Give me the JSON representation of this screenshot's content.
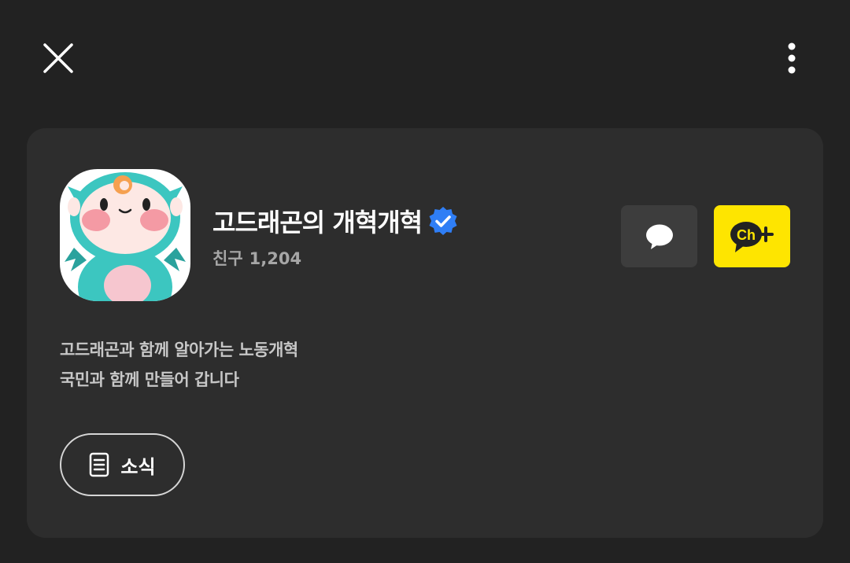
{
  "header": {
    "close_icon": "close-icon",
    "more_icon": "more-vertical-icon"
  },
  "profile": {
    "name": "고드래곤의 개혁개혁",
    "verified_icon": "verified-badge-icon",
    "friends_label": "친구",
    "friends_count": "1,204",
    "description_lines": [
      "고드래곤과 함께 알아가는 노동개혁",
      "국민과 함께 만들어 갑니다"
    ]
  },
  "actions": {
    "chat_icon": "chat-bubble-icon",
    "channel_add_icon": "channel-add-icon",
    "channel_add_text": "Ch"
  },
  "news_button": {
    "label": "소식",
    "icon": "document-icon"
  },
  "colors": {
    "background": "#222222",
    "card": "#2d2d2d",
    "accent_yellow": "#fee500",
    "verified_blue": "#2f7ef5"
  }
}
